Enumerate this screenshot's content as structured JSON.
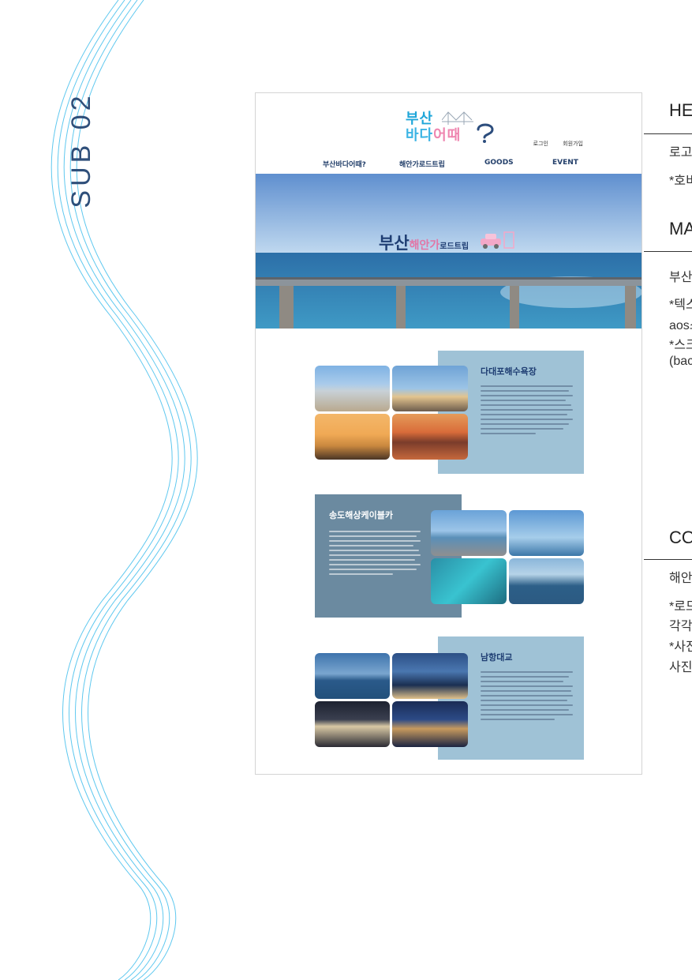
{
  "sub_label": "SUB 02",
  "mockup": {
    "logo": {
      "line1": "부산",
      "line2_a": "바다",
      "line2_b": "어때"
    },
    "util_links": {
      "login": "로그인",
      "signup": "회원가입"
    },
    "nav": [
      "부산바다어때?",
      "해안가로드트립",
      "GOODS",
      "EVENT"
    ],
    "hero": {
      "title_main": "부산",
      "title_accent": "해안가",
      "title_sub": "로드트립"
    },
    "sections": [
      {
        "title": "다대포해수욕장"
      },
      {
        "title": "송도해상케이블카"
      },
      {
        "title": "남항대교"
      }
    ]
  },
  "side_notes": {
    "header_heading": "HE",
    "header_item": "로고",
    "header_note": "*호비",
    "main_heading": "MA",
    "main_item": "부산",
    "main_note1": "*텍스",
    "main_note2": "aos스",
    "main_note3": "*스크",
    "main_note4": "(bac",
    "contents_heading": "CO",
    "contents_item": "해안",
    "contents_note1": "*로드",
    "contents_note2": "각각",
    "contents_note3": "*사진",
    "contents_note4": "사진"
  },
  "colors": {
    "wave": "#5fc8ef",
    "accent_navy": "#1f3e73",
    "panel_blue": "#9fc2d6",
    "panel_dark": "#6b8aa0",
    "pink": "#e276a6"
  }
}
